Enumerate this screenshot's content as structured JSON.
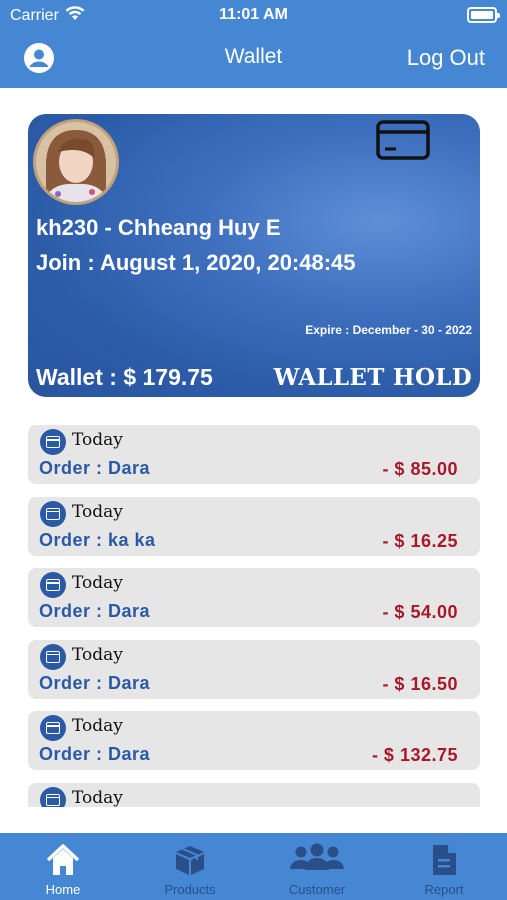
{
  "status_bar": {
    "carrier": "Carrier",
    "time": "11:01 AM"
  },
  "nav": {
    "title": "Wallet",
    "logout_label": "Log Out"
  },
  "card": {
    "name": "kh230 - Chheang Huy E",
    "join": "Join : August 1, 2020, 20:48:45",
    "expire": "Expire : December - 30 - 2022",
    "wallet": "Wallet : $ 179.75",
    "status": "WALLET HOLD"
  },
  "transactions": [
    {
      "date": "Today",
      "order": "Order : Dara",
      "amount": "- $ 85.00"
    },
    {
      "date": "Today",
      "order": "Order : ka ka",
      "amount": "- $ 16.25"
    },
    {
      "date": "Today",
      "order": "Order : Dara",
      "amount": "- $ 54.00"
    },
    {
      "date": "Today",
      "order": "Order : Dara",
      "amount": "- $ 16.50"
    },
    {
      "date": "Today",
      "order": "Order : Dara",
      "amount": "- $ 132.75"
    },
    {
      "date": "Today",
      "order": "",
      "amount": ""
    }
  ],
  "tabs": [
    {
      "label": "Home",
      "icon": "home-icon",
      "active": true
    },
    {
      "label": "Products",
      "icon": "box-icon",
      "active": false
    },
    {
      "label": "Customer",
      "icon": "users-icon",
      "active": false
    },
    {
      "label": "Report",
      "icon": "document-icon",
      "active": false
    }
  ],
  "colors": {
    "primary": "#4687d3",
    "order_text": "#2a5aa5",
    "amount_text": "#a8182a"
  }
}
